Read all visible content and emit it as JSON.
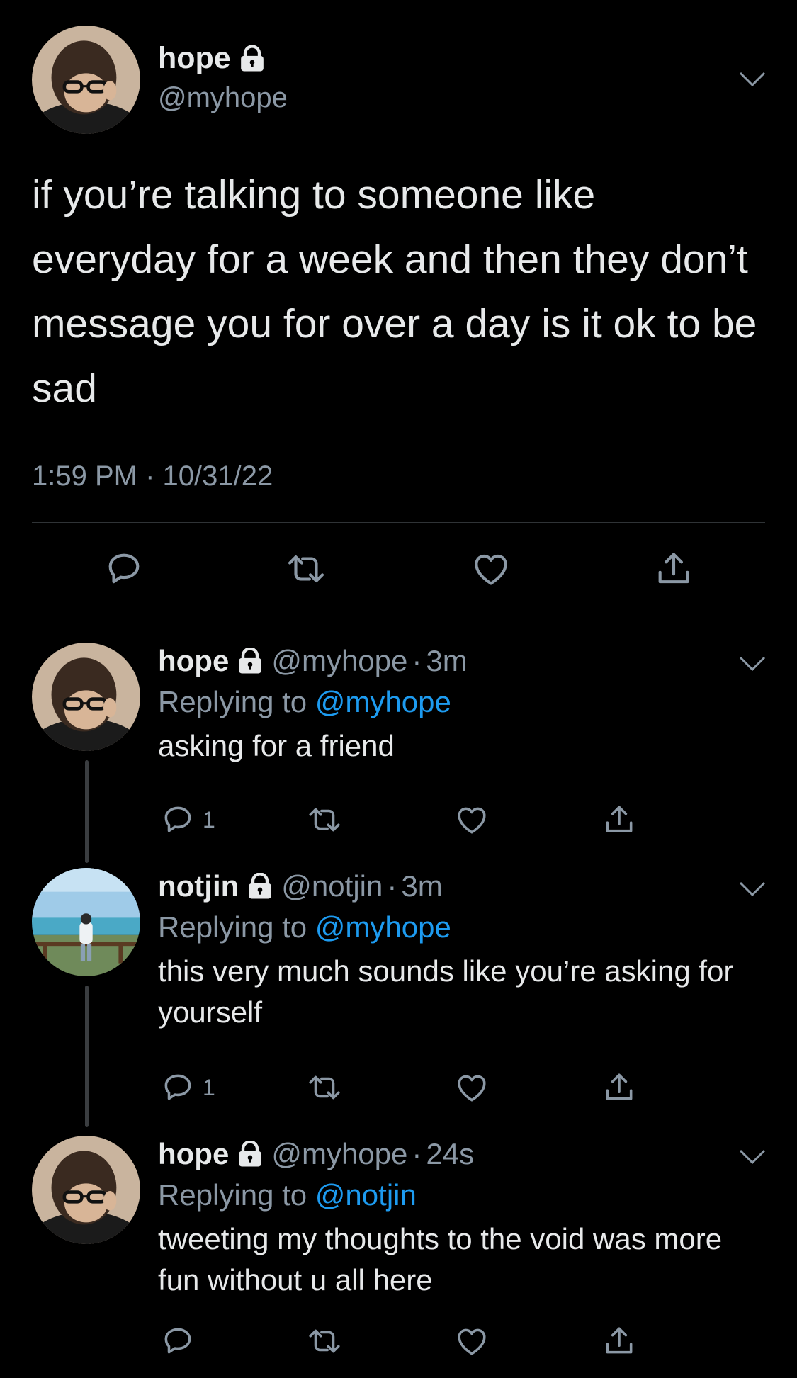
{
  "main_tweet": {
    "author_name": "hope",
    "author_handle": "@myhope",
    "text": "if you’re talking to someone like everyday for a week and then they don’t message you for over a day is it ok to be sad",
    "time": "1:59 PM",
    "separator": "·",
    "date": "10/31/22"
  },
  "replies": [
    {
      "author_name": "hope",
      "author_handle": "@myhope",
      "separator": "·",
      "time": "3m",
      "replying_prefix": "Replying to",
      "replying_to": "@myhope",
      "text": "asking for a friend",
      "reply_count": "1"
    },
    {
      "author_name": "notjin",
      "author_handle": "@notjin",
      "separator": "·",
      "time": "3m",
      "replying_prefix": "Replying to",
      "replying_to": "@myhope",
      "text": "this very much sounds like you’re asking for yourself",
      "reply_count": "1"
    },
    {
      "author_name": "hope",
      "author_handle": "@myhope",
      "separator": "·",
      "time": "24s",
      "replying_prefix": "Replying to",
      "replying_to": "@notjin",
      "text": "tweeting my thoughts to the void was more fun without u all here",
      "reply_count": ""
    }
  ],
  "icons": {
    "lock": "lock-icon",
    "chevron": "chevron-down-icon",
    "reply": "reply-icon",
    "retweet": "retweet-icon",
    "like": "heart-icon",
    "share": "share-icon"
  },
  "colors": {
    "background": "#000000",
    "text": "#e7e9ea",
    "muted": "#8b98a5",
    "link": "#1d9bf0",
    "divider": "#2f3336"
  }
}
